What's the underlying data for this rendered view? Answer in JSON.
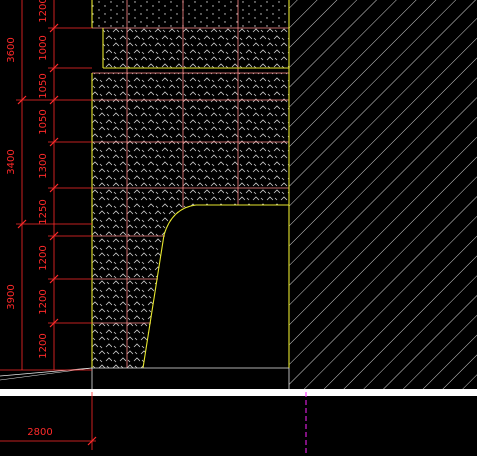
{
  "colors": {
    "background": "#000000",
    "dimension": "#ff2a2a",
    "outline": "#e6e62e",
    "gridline": "#ff8a8a",
    "hatch": "#e8e8e8",
    "band": "#ffffff",
    "centerline": "#ff22ff"
  },
  "dimensions": {
    "total_3600": "3600",
    "total_3400": "3400",
    "total_3900": "3900",
    "seg_1200_top": "1200",
    "seg_1000": "1000",
    "seg_1050_a": "1050",
    "seg_1050_b": "1050",
    "seg_1300": "1300",
    "seg_1250": "1250",
    "seg_1200_a": "1200",
    "seg_1200_b": "1200",
    "seg_1200_c": "1200",
    "bottom_2800": "2800"
  }
}
